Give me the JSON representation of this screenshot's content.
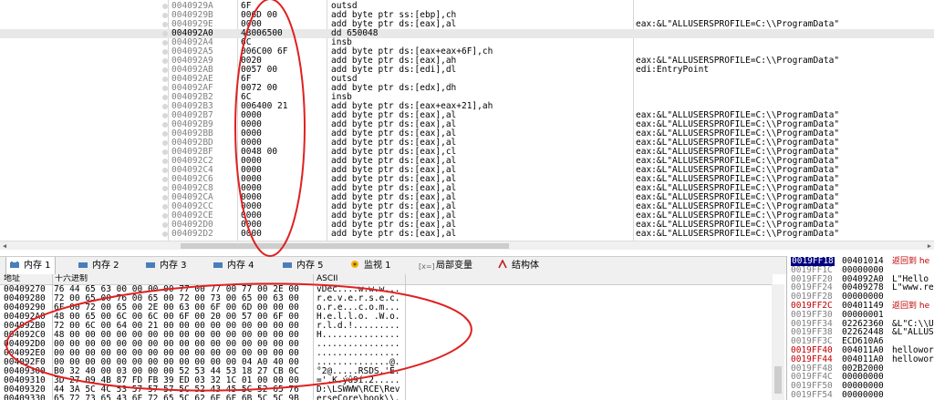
{
  "disasm": {
    "rows": [
      {
        "addr": "0040929A",
        "hex": "6F",
        "ins": "outsd",
        "cmt": ""
      },
      {
        "addr": "0040929B",
        "hex": "006D 00",
        "ins": "add byte ptr ss:[ebp],ch",
        "cmt": ""
      },
      {
        "addr": "0040929E",
        "hex": "0000",
        "ins": "add byte ptr ds:[eax],al",
        "cmt": "eax:&L\"ALLUSERSPROFILE=C:\\\\ProgramData\""
      },
      {
        "addr": "004092A0",
        "hex": "48006500",
        "ins": "dd 650048",
        "cmt": ""
      },
      {
        "addr": "004092A4",
        "hex": "6C",
        "ins": "insb",
        "cmt": ""
      },
      {
        "addr": "004092A5",
        "hex": "006C00 6F",
        "ins": "add byte ptr ds:[eax+eax+6F],ch",
        "cmt": ""
      },
      {
        "addr": "004092A9",
        "hex": "0020",
        "ins": "add byte ptr ds:[eax],ah",
        "cmt": "eax:&L\"ALLUSERSPROFILE=C:\\\\ProgramData\""
      },
      {
        "addr": "004092AB",
        "hex": "0057 00",
        "ins": "add byte ptr ds:[edi],dl",
        "cmt": "edi:EntryPoint"
      },
      {
        "addr": "004092AE",
        "hex": "6F",
        "ins": "outsd",
        "cmt": ""
      },
      {
        "addr": "004092AF",
        "hex": "0072 00",
        "ins": "add byte ptr ds:[edx],dh",
        "cmt": ""
      },
      {
        "addr": "004092B2",
        "hex": "6C",
        "ins": "insb",
        "cmt": ""
      },
      {
        "addr": "004092B3",
        "hex": "006400 21",
        "ins": "add byte ptr ds:[eax+eax+21],ah",
        "cmt": ""
      },
      {
        "addr": "004092B7",
        "hex": "0000",
        "ins": "add byte ptr ds:[eax],al",
        "cmt": "eax:&L\"ALLUSERSPROFILE=C:\\\\ProgramData\""
      },
      {
        "addr": "004092B9",
        "hex": "0000",
        "ins": "add byte ptr ds:[eax],al",
        "cmt": "eax:&L\"ALLUSERSPROFILE=C:\\\\ProgramData\""
      },
      {
        "addr": "004092BB",
        "hex": "0000",
        "ins": "add byte ptr ds:[eax],al",
        "cmt": "eax:&L\"ALLUSERSPROFILE=C:\\\\ProgramData\""
      },
      {
        "addr": "004092BD",
        "hex": "0000",
        "ins": "add byte ptr ds:[eax],al",
        "cmt": "eax:&L\"ALLUSERSPROFILE=C:\\\\ProgramData\""
      },
      {
        "addr": "004092BF",
        "hex": "0048 00",
        "ins": "add byte ptr ds:[eax],cl",
        "cmt": "eax:&L\"ALLUSERSPROFILE=C:\\\\ProgramData\""
      },
      {
        "addr": "004092C2",
        "hex": "0000",
        "ins": "add byte ptr ds:[eax],al",
        "cmt": "eax:&L\"ALLUSERSPROFILE=C:\\\\ProgramData\""
      },
      {
        "addr": "004092C4",
        "hex": "0000",
        "ins": "add byte ptr ds:[eax],al",
        "cmt": "eax:&L\"ALLUSERSPROFILE=C:\\\\ProgramData\""
      },
      {
        "addr": "004092C6",
        "hex": "0000",
        "ins": "add byte ptr ds:[eax],al",
        "cmt": "eax:&L\"ALLUSERSPROFILE=C:\\\\ProgramData\""
      },
      {
        "addr": "004092C8",
        "hex": "0000",
        "ins": "add byte ptr ds:[eax],al",
        "cmt": "eax:&L\"ALLUSERSPROFILE=C:\\\\ProgramData\""
      },
      {
        "addr": "004092CA",
        "hex": "0000",
        "ins": "add byte ptr ds:[eax],al",
        "cmt": "eax:&L\"ALLUSERSPROFILE=C:\\\\ProgramData\""
      },
      {
        "addr": "004092CC",
        "hex": "0000",
        "ins": "add byte ptr ds:[eax],al",
        "cmt": "eax:&L\"ALLUSERSPROFILE=C:\\\\ProgramData\""
      },
      {
        "addr": "004092CE",
        "hex": "0000",
        "ins": "add byte ptr ds:[eax],al",
        "cmt": "eax:&L\"ALLUSERSPROFILE=C:\\\\ProgramData\""
      },
      {
        "addr": "004092D0",
        "hex": "0000",
        "ins": "add byte ptr ds:[eax],al",
        "cmt": "eax:&L\"ALLUSERSPROFILE=C:\\\\ProgramData\""
      },
      {
        "addr": "004092D2",
        "hex": "0000",
        "ins": "add byte ptr ds:[eax],al",
        "cmt": "eax:&L\"ALLUSERSPROFILE=C:\\\\ProgramData\""
      }
    ],
    "selected_index": 3
  },
  "tabs": [
    {
      "label": "内存 1",
      "icon": "memory-icon"
    },
    {
      "label": "内存 2",
      "icon": "memory-icon"
    },
    {
      "label": "内存 3",
      "icon": "memory-icon"
    },
    {
      "label": "内存 4",
      "icon": "memory-icon"
    },
    {
      "label": "内存 5",
      "icon": "memory-icon"
    },
    {
      "label": "监视 1",
      "icon": "watch-icon"
    },
    {
      "label": "局部变量",
      "icon": "locals-icon"
    },
    {
      "label": "结构体",
      "icon": "struct-icon"
    }
  ],
  "dump": {
    "headers": {
      "addr": "地址",
      "hex": "十六进制",
      "ascii": "ASCII"
    },
    "rows": [
      {
        "addr": "00409270",
        "hex": "76 44 65 63 00 00 00 00 77 00 77 00 77 00 2E 00",
        "ascii": "vDec....w.w.w..."
      },
      {
        "addr": "00409280",
        "hex": "72 00 65 00 76 00 65 00 72 00 73 00 65 00 63 00",
        "ascii": "r.e.v.e.r.s.e.c."
      },
      {
        "addr": "00409290",
        "hex": "6F 00 72 00 65 00 2E 00 63 00 6F 00 6D 00 00 00",
        "ascii": "o.r.e...c.o.m..."
      },
      {
        "addr": "004092A0",
        "hex": "48 00 65 00 6C 00 6C 00 6F 00 20 00 57 00 6F 00",
        "ascii": "H.e.l.l.o. .W.o."
      },
      {
        "addr": "004092B0",
        "hex": "72 00 6C 00 64 00 21 00 00 00 00 00 00 00 00 00",
        "ascii": "r.l.d.!........."
      },
      {
        "addr": "004092C0",
        "hex": "48 00 00 00 00 00 00 00 00 00 00 00 00 00 00 00",
        "ascii": "H..............."
      },
      {
        "addr": "004092D0",
        "hex": "00 00 00 00 00 00 00 00 00 00 00 00 00 00 00 00",
        "ascii": "................"
      },
      {
        "addr": "004092E0",
        "hex": "00 00 00 00 00 00 00 00 00 00 00 00 00 00 00 00",
        "ascii": "................"
      },
      {
        "addr": "004092F0",
        "hex": "00 00 00 00 00 00 00 00 00 00 00 00 04 A0 40 00",
        "ascii": "..............@."
      },
      {
        "addr": "00409300",
        "hex": "B0 32 40 00 03 00 00 00 52 53 44 53 18 27 CB 0C",
        "ascii": "°2@.....RSDS.'Ë."
      },
      {
        "addr": "00409310",
        "hex": "3D 27 09 4B 87 FD FB 39 ED 03 32 1C 01 00 00 00",
        "ascii": "='.K.ýû9í.2....."
      },
      {
        "addr": "00409320",
        "hex": "44 3A 5C 4C 53 57 57 57 5C 52 43 45 5C 52 65 76",
        "ascii": "D:\\LSWWW\\RCE\\Rev"
      },
      {
        "addr": "00409330",
        "hex": "65 72 73 65 43 6F 72 65 5C 62 6F 6F 6B 5C 5C 9B",
        "ascii": "erseCore\\book\\\\."
      }
    ]
  },
  "stack": {
    "rows": [
      {
        "addr": "0019FF18",
        "val": "00401014",
        "cmt": "返回到 he",
        "style": "cur"
      },
      {
        "addr": "0019FF1C",
        "val": "00000000",
        "cmt": "",
        "style": ""
      },
      {
        "addr": "0019FF20",
        "val": "004092A0",
        "cmt": "L\"Hello",
        "style": ""
      },
      {
        "addr": "0019FF24",
        "val": "00409278",
        "cmt": "L\"www.re",
        "style": ""
      },
      {
        "addr": "0019FF28",
        "val": "00000000",
        "cmt": "",
        "style": ""
      },
      {
        "addr": "0019FF2C",
        "val": "00401149",
        "cmt": "返回到 he",
        "style": "red"
      },
      {
        "addr": "0019FF30",
        "val": "00000001",
        "cmt": "",
        "style": ""
      },
      {
        "addr": "0019FF34",
        "val": "02262360",
        "cmt": "&L\"C:\\\\U",
        "style": ""
      },
      {
        "addr": "0019FF38",
        "val": "02262448",
        "cmt": "&L\"ALLUS",
        "style": ""
      },
      {
        "addr": "0019FF3C",
        "val": "ECD610A6",
        "cmt": "",
        "style": ""
      },
      {
        "addr": "0019FF40",
        "val": "004011A0",
        "cmt": "helloworl",
        "style": "red"
      },
      {
        "addr": "0019FF44",
        "val": "004011A0",
        "cmt": "helloworl",
        "style": "red"
      },
      {
        "addr": "0019FF48",
        "val": "002B2000",
        "cmt": "",
        "style": ""
      },
      {
        "addr": "0019FF4C",
        "val": "00000000",
        "cmt": "",
        "style": ""
      },
      {
        "addr": "0019FF50",
        "val": "00000000",
        "cmt": "",
        "style": ""
      },
      {
        "addr": "0019FF54",
        "val": "00000000",
        "cmt": "",
        "style": ""
      }
    ]
  },
  "colors": {
    "annotation": "#e02020",
    "selection": "#000080",
    "hl": "#d9d2e9",
    "red_text": "#c00000"
  }
}
